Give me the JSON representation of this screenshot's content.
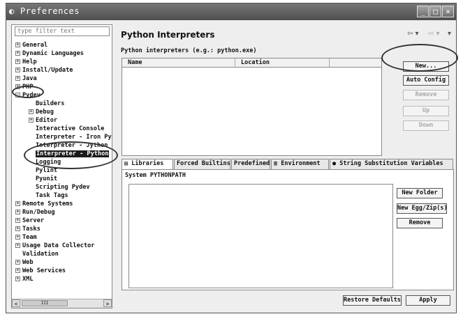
{
  "window": {
    "title": "Preferences",
    "icon": "eclipse-icon",
    "controls": [
      "_",
      "□",
      "✕"
    ]
  },
  "sidebar": {
    "filter_placeholder": "type filter text",
    "items": [
      {
        "label": "General",
        "exp": "+"
      },
      {
        "label": "Dynamic Languages",
        "exp": "+"
      },
      {
        "label": "Help",
        "exp": "+"
      },
      {
        "label": "Install/Update",
        "exp": "+"
      },
      {
        "label": "Java",
        "exp": "+"
      },
      {
        "label": "PHP",
        "exp": "+"
      },
      {
        "label": "Pydev",
        "exp": "-"
      },
      {
        "label": "Builders"
      },
      {
        "label": "Debug",
        "exp": "+"
      },
      {
        "label": "Editor",
        "exp": "+"
      },
      {
        "label": "Interactive Console"
      },
      {
        "label": "Interpreter - Iron Py"
      },
      {
        "label": "Interpreter - Jython"
      },
      {
        "label": "Interpreter - Python",
        "selected": true
      },
      {
        "label": "Logging"
      },
      {
        "label": "Pylint"
      },
      {
        "label": "Pyunit"
      },
      {
        "label": "Scripting Pydev"
      },
      {
        "label": "Task Tags"
      },
      {
        "label": "Remote Systems",
        "exp": "+"
      },
      {
        "label": "Run/Debug",
        "exp": "+"
      },
      {
        "label": "Server",
        "exp": "+"
      },
      {
        "label": "Tasks",
        "exp": "+"
      },
      {
        "label": "Team",
        "exp": "+"
      },
      {
        "label": "Usage Data Collector",
        "exp": "+"
      },
      {
        "label": "Validation"
      },
      {
        "label": "Web",
        "exp": "+"
      },
      {
        "label": "Web Services",
        "exp": "+"
      },
      {
        "label": "XML",
        "exp": "+"
      }
    ],
    "scroll_left": "<",
    "scroll_right": ">",
    "scroll_thumb": "III"
  },
  "page": {
    "title": "Python Interpreters",
    "nav_back": "⇦ ▾",
    "nav_fwd": "⇨ ▾",
    "nav_menu": "▾",
    "description": "Python interpreters (e.g.: python.exe)",
    "table_cols": [
      "Name",
      "Location"
    ],
    "buttons": {
      "new": "New...",
      "auto_config": "Auto Config",
      "remove": "Remove",
      "up": "Up",
      "down": "Down"
    },
    "tabs": [
      {
        "label": "Libraries",
        "icon": "books-icon",
        "active": true
      },
      {
        "label": "Forced Builtins"
      },
      {
        "label": "Predefined"
      },
      {
        "label": "Environment",
        "icon": "environment-icon"
      },
      {
        "label": "String Substitution Variables",
        "icon": "dot-icon"
      }
    ],
    "system_path_label": "System PYTHONPATH",
    "path_buttons": {
      "new_folder": "New Folder",
      "new_egg": "New Egg/Zip(s)",
      "remove": "Remove"
    },
    "restore_defaults": "Restore Defaults",
    "apply": "Apply"
  }
}
